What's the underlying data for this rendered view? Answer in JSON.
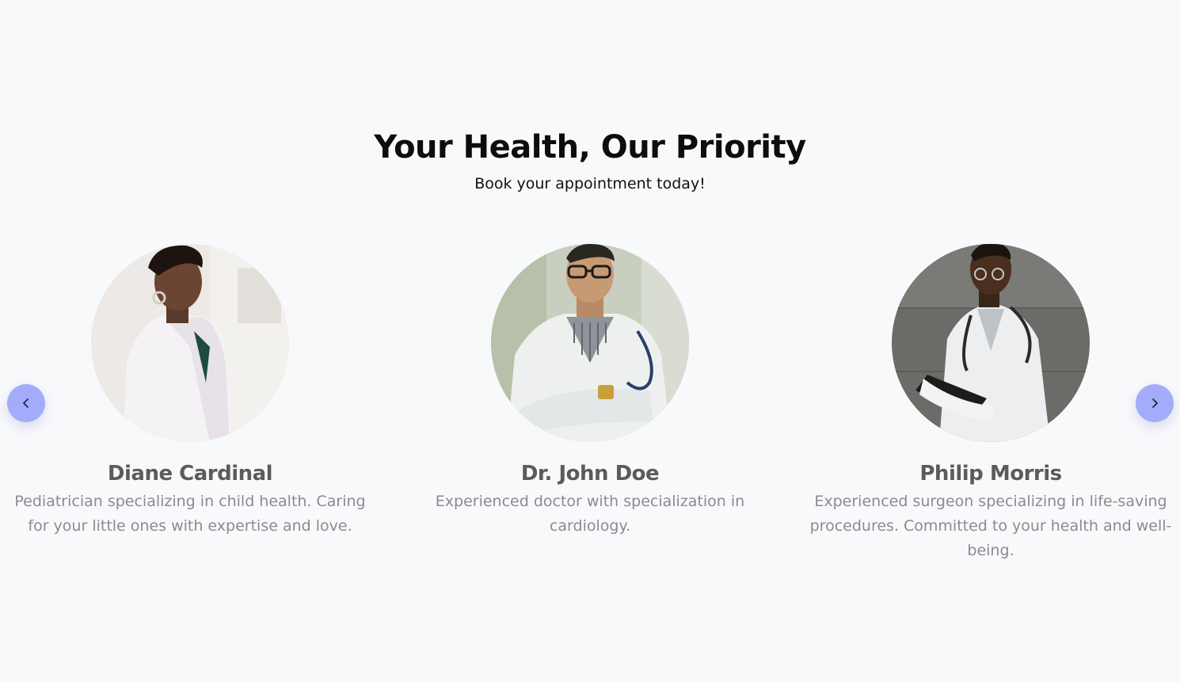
{
  "hero": {
    "title": "Your Health, Our Priority",
    "subtitle": "Book your appointment today!"
  },
  "carousel": {
    "prev_icon": "chevron-left-icon",
    "next_icon": "chevron-right-icon",
    "button_color": "#a3acfb",
    "doctors": [
      {
        "name": "Diane Cardinal",
        "description": "Pediatrician specializing in child health. Caring for your little ones with expertise and love.",
        "photo": "doctor-portrait-woman"
      },
      {
        "name": "Dr. John Doe",
        "description": "Experienced doctor with specialization in cardiology.",
        "photo": "doctor-portrait-older-man"
      },
      {
        "name": "Philip Morris",
        "description": "Experienced surgeon specializing in life-saving procedures. Committed to your health and well-being.",
        "photo": "doctor-portrait-man-with-tablet"
      }
    ]
  }
}
